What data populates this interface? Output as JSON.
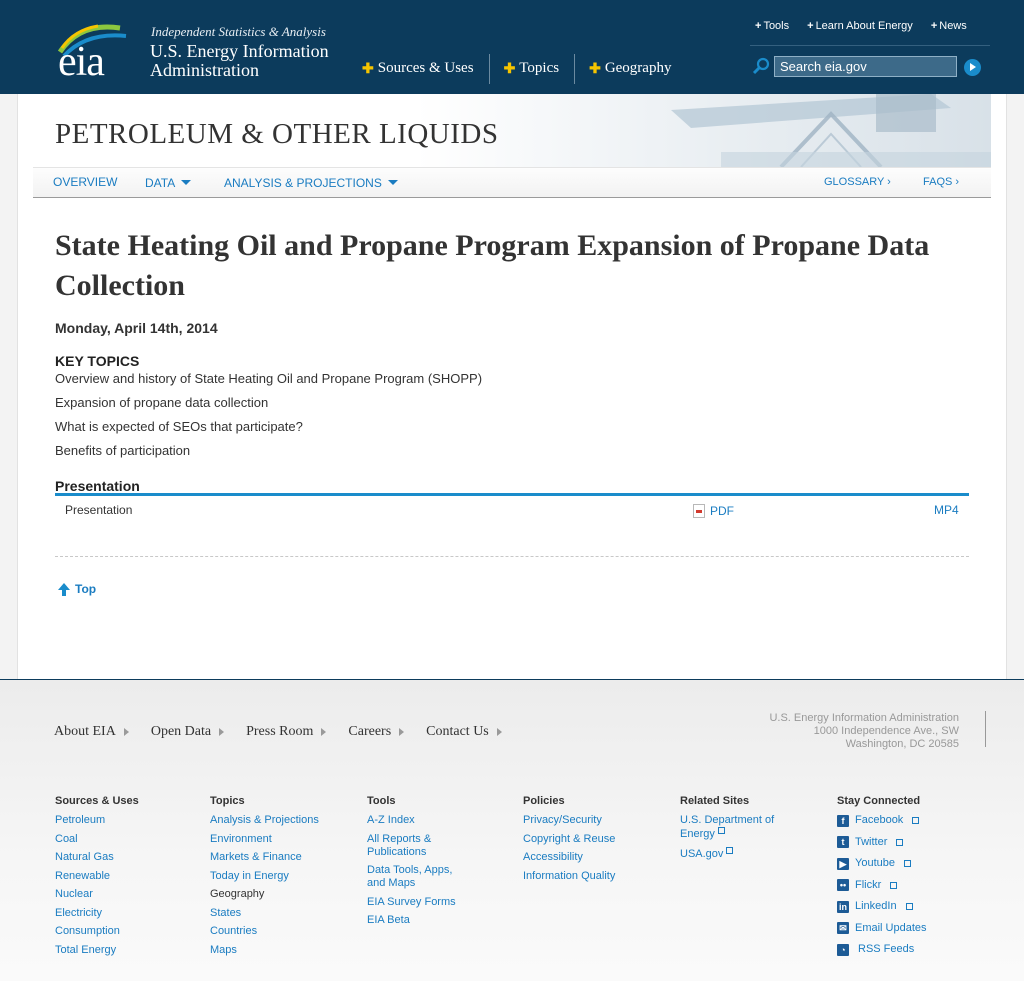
{
  "header": {
    "logo_text": "eia",
    "tagline": "Independent Statistics & Analysis",
    "agency_line1": "U.S. Energy Information",
    "agency_line2": "Administration",
    "main_nav": [
      "Sources & Uses",
      "Topics",
      "Geography"
    ],
    "utility_nav": [
      "Tools",
      "Learn About Energy",
      "News"
    ],
    "search": {
      "value": "Search eia.gov"
    }
  },
  "section": {
    "title": "PETROLEUM & OTHER LIQUIDS",
    "subnav": {
      "overview": "OVERVIEW",
      "data": "DATA",
      "analysis": "ANALYSIS & PROJECTIONS",
      "glossary": "GLOSSARY ›",
      "faqs": "FAQS ›"
    }
  },
  "article": {
    "title": "State Heating Oil and Propane Program Expansion of Propane Data Collection",
    "date": "Monday, April 14th, 2014",
    "key_topics_heading": "KEY TOPICS",
    "key_topics": [
      "Overview and history of State Heating Oil and Propane Program (SHOPP)",
      "Expansion of propane data collection",
      "What is expected of SEOs that participate?",
      "Benefits of participation"
    ],
    "presentation_heading": "Presentation",
    "presentation_row": {
      "label": "Presentation",
      "pdf": "PDF",
      "mp4": "MP4"
    },
    "top_link": "Top"
  },
  "footer": {
    "nav": [
      "About EIA",
      "Open Data",
      "Press Room",
      "Careers",
      "Contact Us"
    ],
    "address": [
      "U.S. Energy Information Administration",
      "1000 Independence Ave., SW",
      "Washington, DC 20585"
    ],
    "columns": {
      "sources": {
        "heading": "Sources & Uses",
        "links": [
          "Petroleum",
          "Coal",
          "Natural Gas",
          "Renewable",
          "Nuclear",
          "Electricity",
          "Consumption",
          "Total Energy"
        ]
      },
      "topics": {
        "heading": "Topics",
        "links": [
          "Analysis & Projections",
          "Environment",
          "Markets & Finance",
          "Today in Energy"
        ],
        "subheading": "Geography",
        "sublinks": [
          "States",
          "Countries",
          "Maps"
        ]
      },
      "tools": {
        "heading": "Tools",
        "links": [
          "A-Z Index",
          "All Reports & Publications",
          "Data Tools, Apps, and Maps",
          "EIA Survey Forms",
          "EIA Beta"
        ]
      },
      "policies": {
        "heading": "Policies",
        "links": [
          "Privacy/Security",
          "Copyright & Reuse",
          "Accessibility",
          "Information Quality"
        ]
      },
      "related": {
        "heading": "Related Sites",
        "links": [
          "U.S. Department of Energy",
          "USA.gov"
        ]
      },
      "stay": {
        "heading": "Stay Connected",
        "links": [
          "Facebook",
          "Twitter",
          "Youtube",
          "Flickr",
          "LinkedIn",
          "Email Updates",
          "RSS Feeds"
        ]
      }
    }
  }
}
